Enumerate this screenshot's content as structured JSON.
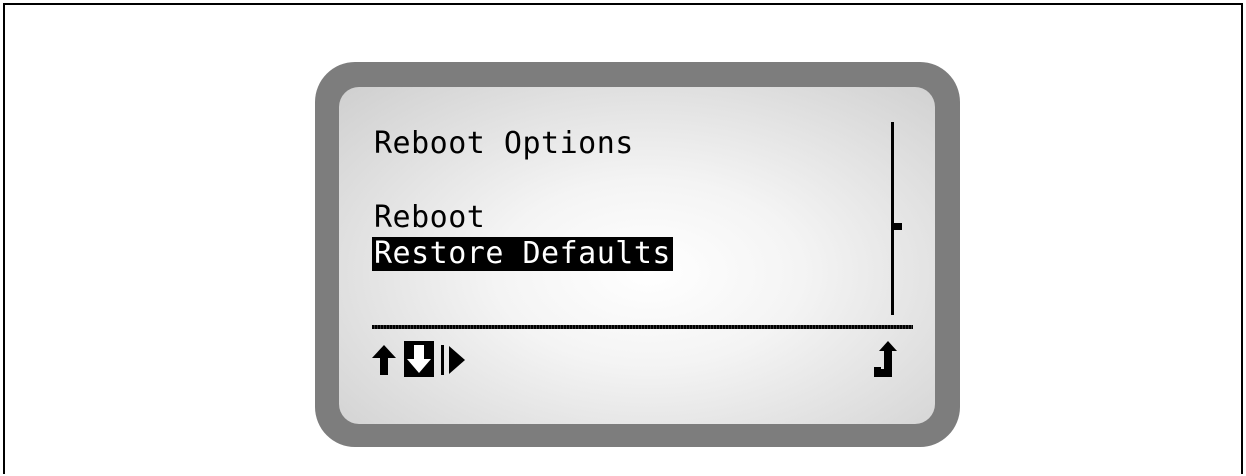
{
  "menu": {
    "title": "Reboot Options",
    "items": [
      {
        "label": "Reboot",
        "selected": false
      },
      {
        "label": "Restore Defaults",
        "selected": true
      }
    ]
  },
  "footer": {
    "icons": [
      "up-arrow-icon",
      "down-arrow-icon",
      "right-arrow-icon",
      "enter-icon"
    ]
  },
  "colors": {
    "bezel": "#7d7d7d",
    "screen": "#f4f4f4",
    "ink": "#000000",
    "highlight_text": "#ffffff"
  }
}
